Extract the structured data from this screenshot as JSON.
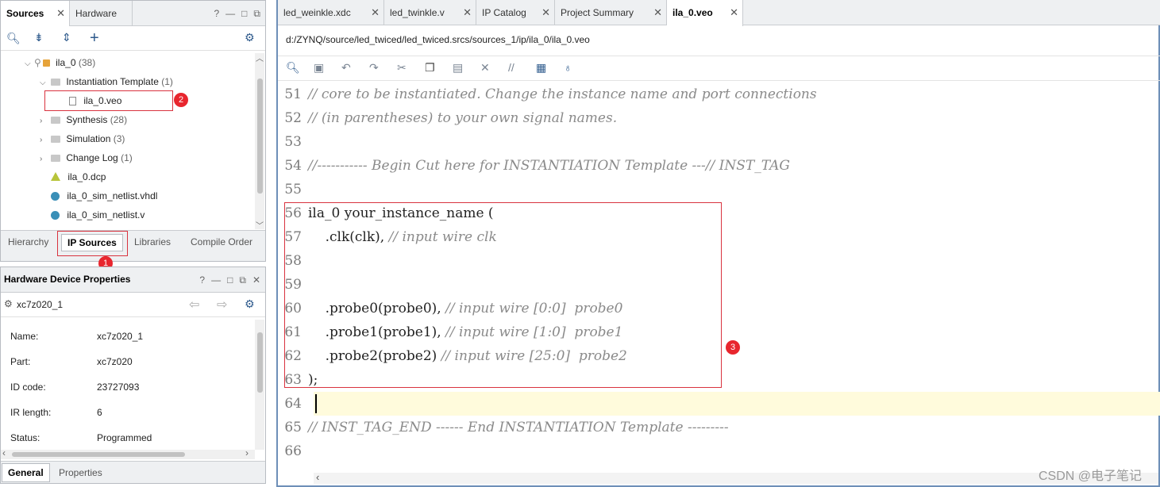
{
  "sources_panel": {
    "tabs": [
      {
        "label": "Sources",
        "active": true
      },
      {
        "label": "Hardware",
        "active": false
      }
    ],
    "header_buttons": [
      "?",
      "—",
      "□",
      "⧉"
    ],
    "tree": [
      {
        "label": "ila_0",
        "count": "(38)"
      },
      {
        "label": "Instantiation Template",
        "count": "(1)"
      },
      {
        "label": "ila_0.veo",
        "count": ""
      },
      {
        "label": "Synthesis",
        "count": "(28)"
      },
      {
        "label": "Simulation",
        "count": "(3)"
      },
      {
        "label": "Change Log",
        "count": "(1)"
      },
      {
        "label": "ila_0.dcp",
        "count": ""
      },
      {
        "label": "ila_0_sim_netlist.vhdl",
        "count": ""
      },
      {
        "label": "ila_0_sim_netlist.v",
        "count": ""
      }
    ],
    "bottom_tabs": [
      "Hierarchy",
      "IP Sources",
      "Libraries",
      "Compile Order"
    ]
  },
  "props_panel": {
    "title": "Hardware Device Properties",
    "header_buttons": [
      "?",
      "—",
      "□",
      "⧉",
      "✕"
    ],
    "device": "xc7z020_1",
    "rows": [
      {
        "key": "Name:",
        "value": "xc7z020_1"
      },
      {
        "key": "Part:",
        "value": "xc7z020"
      },
      {
        "key": "ID code:",
        "value": "23727093"
      },
      {
        "key": "IR length:",
        "value": "6"
      },
      {
        "key": "Status:",
        "value": "Programmed"
      }
    ],
    "bottom_tabs": [
      "General",
      "Properties"
    ]
  },
  "editor": {
    "tabs": [
      {
        "label": "led_weinkle.xdc",
        "active": false
      },
      {
        "label": "led_twinkle.v",
        "active": false
      },
      {
        "label": "IP Catalog",
        "active": false
      },
      {
        "label": "Project Summary",
        "active": false
      },
      {
        "label": "ila_0.veo",
        "active": true
      }
    ],
    "path": "d:/ZYNQ/source/led_twiced/led_twiced.srcs/sources_1/ip/ila_0/ila_0.veo",
    "lines": [
      {
        "n": "51",
        "code": "",
        "comment": "// core to be instantiated. Change the instance name and port connections"
      },
      {
        "n": "52",
        "code": "",
        "comment": "// (in parentheses) to your own signal names."
      },
      {
        "n": "53",
        "code": "",
        "comment": ""
      },
      {
        "n": "54",
        "code": "",
        "comment": "//----------- Begin Cut here for INSTANTIATION Template ---// INST_TAG"
      },
      {
        "n": "55",
        "code": "",
        "comment": ""
      },
      {
        "n": "56",
        "code": "ila_0 your_instance_name (",
        "comment": ""
      },
      {
        "n": "57",
        "code": "    .clk(clk), ",
        "comment": "// input wire clk"
      },
      {
        "n": "58",
        "code": "",
        "comment": ""
      },
      {
        "n": "59",
        "code": "",
        "comment": ""
      },
      {
        "n": "60",
        "code": "    .probe0(probe0), ",
        "comment": "// input wire [0:0]  probe0"
      },
      {
        "n": "61",
        "code": "    .probe1(probe1), ",
        "comment": "// input wire [1:0]  probe1"
      },
      {
        "n": "62",
        "code": "    .probe2(probe2) ",
        "comment": "// input wire [25:0]  probe2"
      },
      {
        "n": "63",
        "code": ");",
        "comment": ""
      },
      {
        "n": "64",
        "code": "",
        "comment": ""
      },
      {
        "n": "65",
        "code": "",
        "comment": "// INST_TAG_END ------ End INSTANTIATION Template ---------"
      },
      {
        "n": "66",
        "code": "",
        "comment": ""
      }
    ]
  },
  "annotations": [
    "1",
    "2",
    "3"
  ],
  "watermark": "CSDN @电子笔记",
  "colors": {
    "accent": "#2e5a8c",
    "highlight_line": "#fffbdc",
    "callout": "#e8262e"
  }
}
